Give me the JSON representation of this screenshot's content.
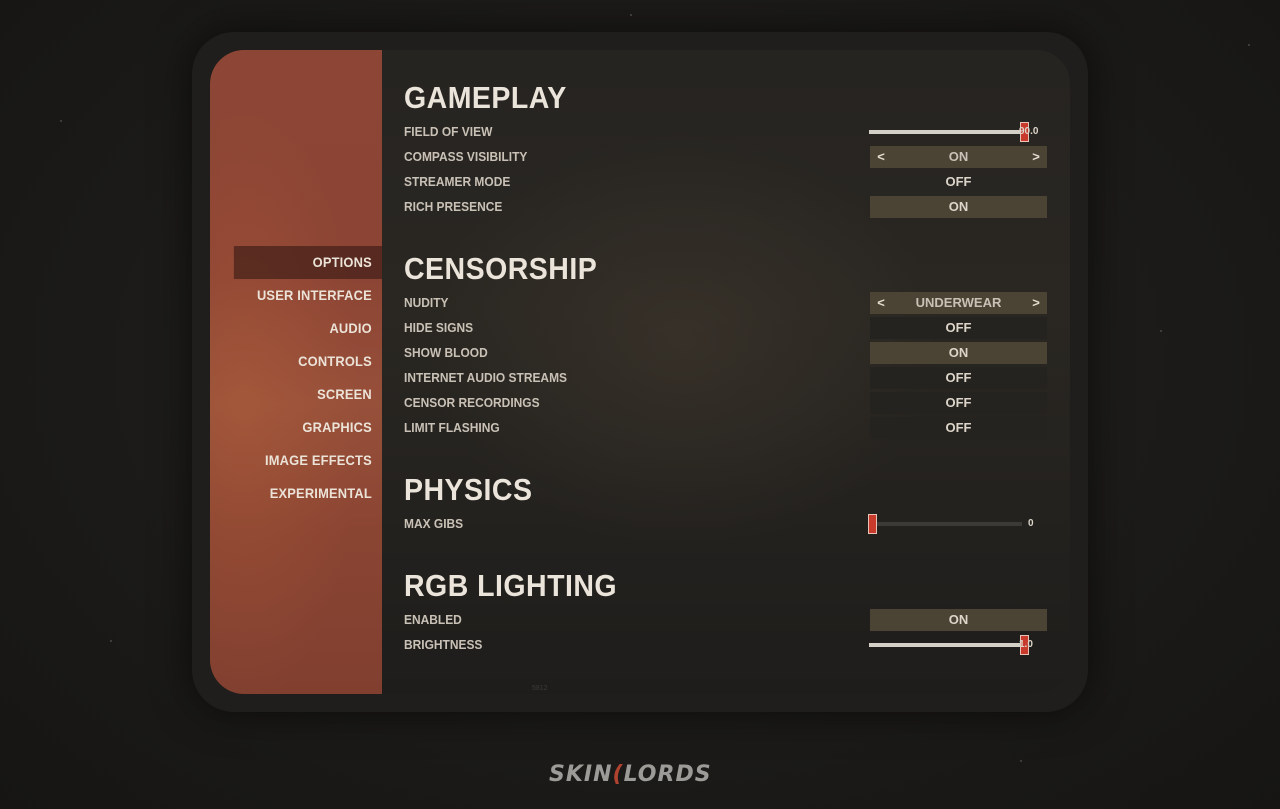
{
  "sidebar": {
    "items": [
      {
        "label": "OPTIONS",
        "active": true
      },
      {
        "label": "USER INTERFACE",
        "active": false
      },
      {
        "label": "AUDIO",
        "active": false
      },
      {
        "label": "CONTROLS",
        "active": false
      },
      {
        "label": "SCREEN",
        "active": false
      },
      {
        "label": "GRAPHICS",
        "active": false
      },
      {
        "label": "IMAGE EFFECTS",
        "active": false
      },
      {
        "label": "EXPERIMENTAL",
        "active": false
      }
    ]
  },
  "sections": {
    "gameplay": {
      "title": "GAMEPLAY",
      "field_of_view": {
        "label": "FIELD OF VIEW",
        "value": "90.0",
        "fraction": 0.98
      },
      "compass_visibility": {
        "label": "COMPASS VISIBILITY",
        "value": "ON",
        "prev": "<",
        "next": ">"
      },
      "streamer_mode": {
        "label": "STREAMER MODE",
        "value": "OFF"
      },
      "rich_presence": {
        "label": "RICH PRESENCE",
        "value": "ON"
      }
    },
    "censorship": {
      "title": "CENSORSHIP",
      "nudity": {
        "label": "NUDITY",
        "value": "UNDERWEAR",
        "prev": "<",
        "next": ">"
      },
      "hide_signs": {
        "label": "HIDE SIGNS",
        "value": "OFF"
      },
      "show_blood": {
        "label": "SHOW BLOOD",
        "value": "ON"
      },
      "internet_audio_streams": {
        "label": "INTERNET AUDIO STREAMS",
        "value": "OFF"
      },
      "censor_recordings": {
        "label": "CENSOR RECORDINGS",
        "value": "OFF"
      },
      "limit_flashing": {
        "label": "LIMIT FLASHING",
        "value": "OFF"
      }
    },
    "physics": {
      "title": "PHYSICS",
      "max_gibs": {
        "label": "MAX GIBS",
        "value": "0",
        "fraction": 0.0
      }
    },
    "rgb_lighting": {
      "title": "RGB LIGHTING",
      "enabled": {
        "label": "ENABLED",
        "value": "ON"
      },
      "brightness": {
        "label": "BRIGHTNESS",
        "value": "1.0",
        "fraction": 0.98
      }
    }
  },
  "footer": {
    "build": "5812",
    "logo_left": "SKIN",
    "logo_sep": "(",
    "logo_right": "LORDS"
  },
  "colors": {
    "sidebar_accent": "#8d4635",
    "toggle_on": "#4b4434",
    "slider_thumb": "#c83a2b"
  }
}
